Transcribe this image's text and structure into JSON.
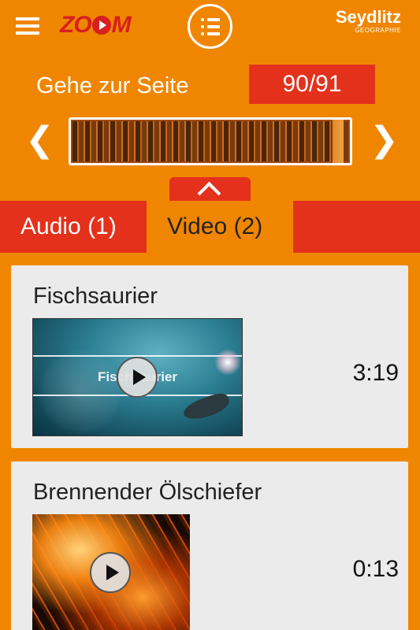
{
  "header": {
    "menu_icon": "hamburger-icon",
    "logo_text_left": "ZO",
    "logo_text_right": "M",
    "toc_icon": "list-icon",
    "brand_name": "Seydlitz",
    "brand_sub": "GEOGRAPHIE"
  },
  "navigation": {
    "goto_label": "Gehe zur Seite",
    "page_value": "90/91",
    "prev_icon": "chevron-left-icon",
    "next_icon": "chevron-right-icon",
    "prev_glyph": "❮",
    "next_glyph": "❯",
    "collapse_icon": "chevron-up-icon"
  },
  "tabs": [
    {
      "label": "Audio (1)",
      "active": false
    },
    {
      "label": "Video (2)",
      "active": true
    }
  ],
  "videos": [
    {
      "title": "Fischsaurier",
      "duration": "3:19",
      "thumbnail_text": "Fischsaurier"
    },
    {
      "title": "Brennender Ölschiefer",
      "duration": "0:13"
    }
  ],
  "colors": {
    "background": "#f08600",
    "accent_red": "#e3311c",
    "card": "#ebebeb"
  }
}
